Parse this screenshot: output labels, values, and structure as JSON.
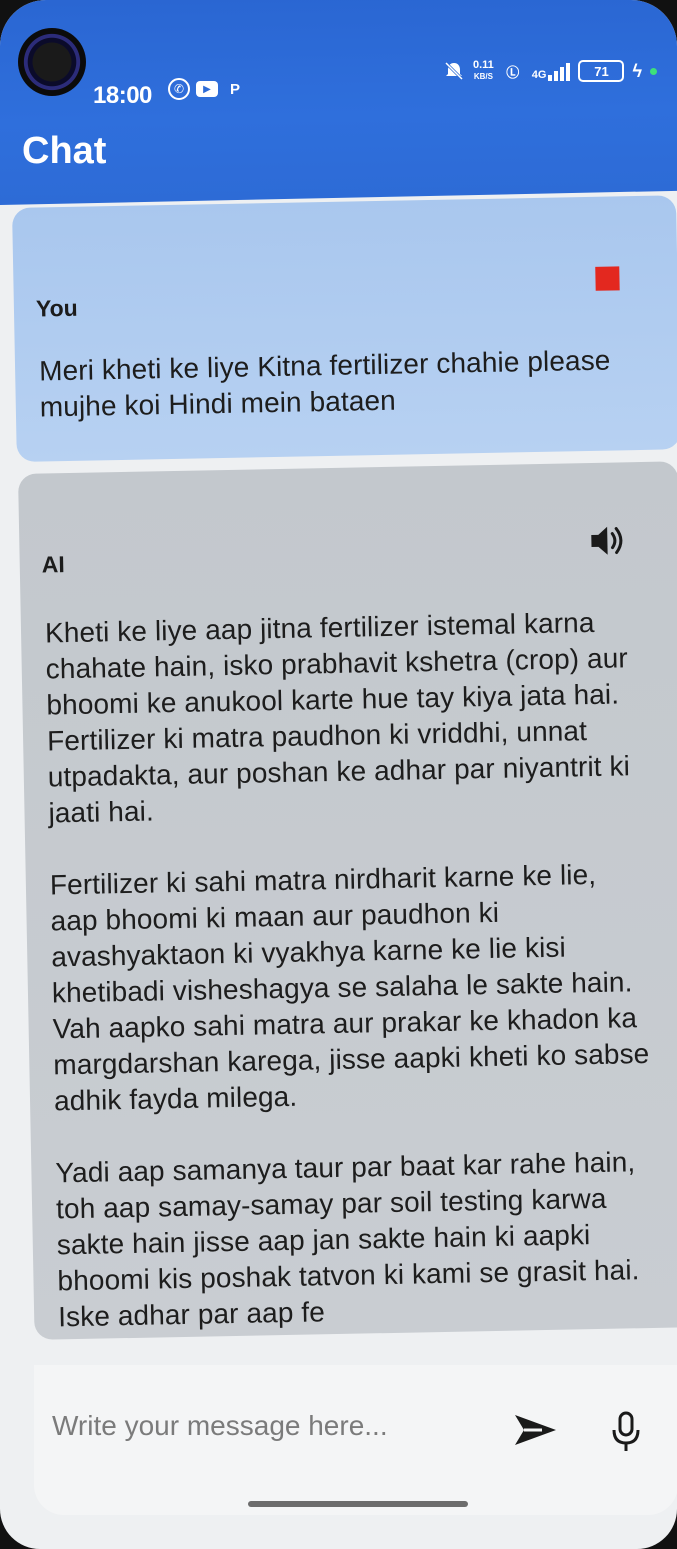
{
  "status_bar": {
    "time": "18:00",
    "net_speed": "0.11",
    "net_unit": "KB/S",
    "network_type": "4G",
    "battery": "71"
  },
  "app_bar": {
    "title": "Chat"
  },
  "messages": [
    {
      "sender": "You",
      "text": "Meri kheti ke liye Kitna fertilizer chahie please mujhe koi Hindi mein bataen",
      "action_icon": "stop-icon"
    },
    {
      "sender": "AI",
      "action_icon": "speaker-icon",
      "paragraphs": [
        "Kheti ke liye aap jitna fertilizer istemal karna chahate hain, isko prabhavit kshetra (crop) aur bhoomi ke anukool karte hue tay kiya jata hai. Fertilizer ki matra paudhon ki vriddhi, unnat utpadakta, aur poshan ke adhar par niyantrit ki jaati hai.",
        "Fertilizer ki sahi matra nirdharit karne ke lie, aap bhoomi ki maan aur paudhon ki avashyaktaon ki vyakhya karne ke lie kisi khetibadi visheshagya se salaha le sakte hain. Vah aapko sahi matra aur prakar ke khadon ka margdarshan karega, jisse aapki kheti ko sabse adhik fayda milega.",
        "Yadi aap samanya taur par baat kar rahe hain, toh aap samay-samay par soil testing karwa sakte hain jisse aap jan sakte hain ki aapki bhoomi kis poshak tatvon ki kami se grasit hai. Iske adhar par aap fe"
      ]
    }
  ],
  "composer": {
    "placeholder": "Write your message here...",
    "value": ""
  },
  "colors": {
    "app_bar": "#2d6bd6",
    "user_bubble": "#b0ccf0",
    "ai_bubble": "#c6cacf",
    "stop": "#e3281f"
  }
}
